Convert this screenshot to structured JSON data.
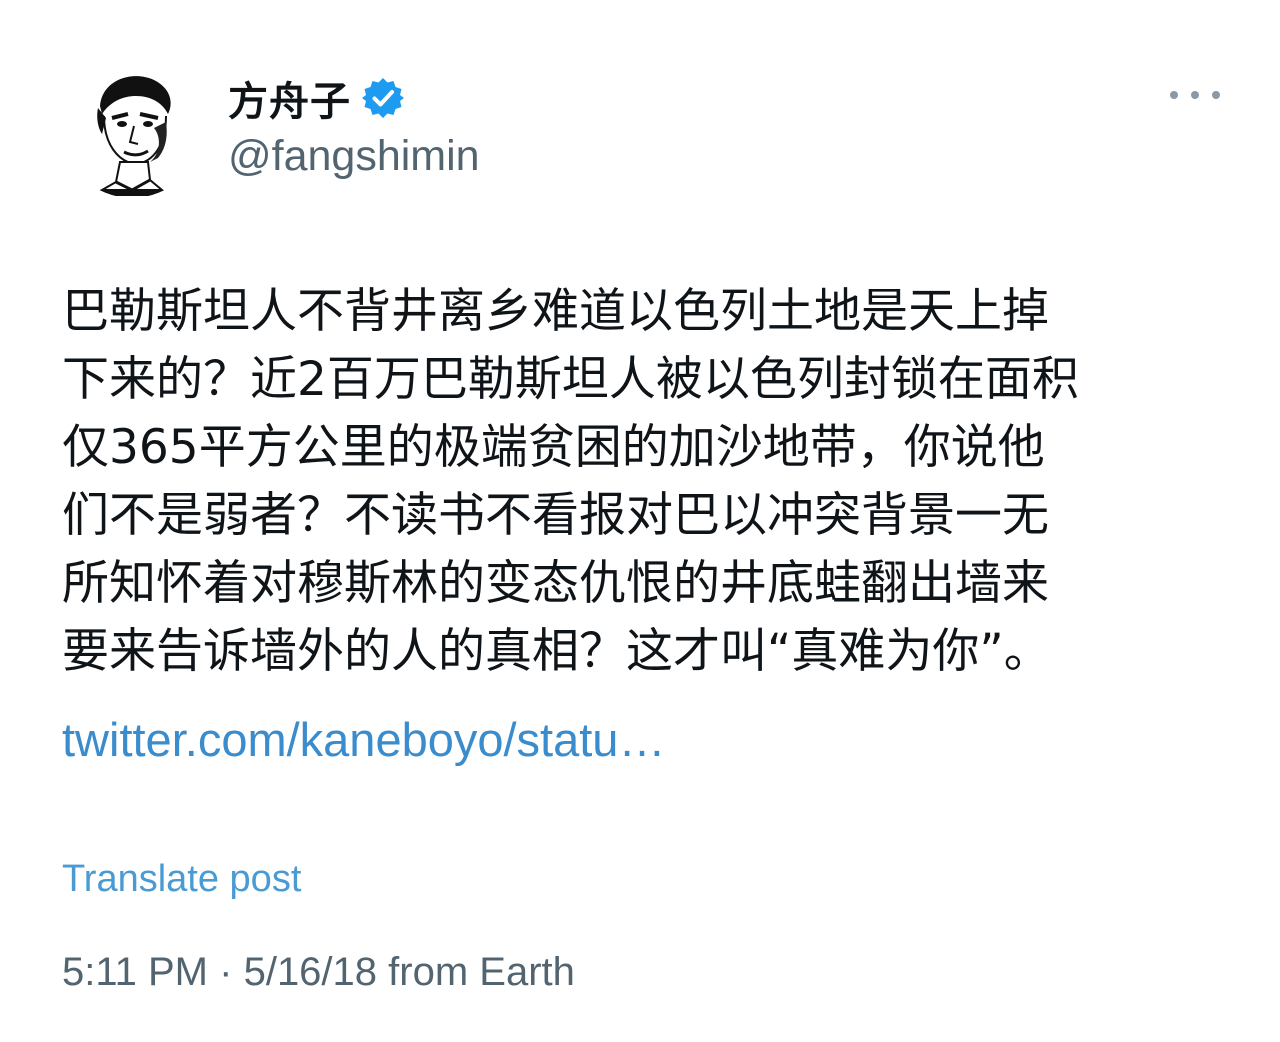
{
  "author": {
    "display_name": "方舟子",
    "handle": "@fangshimin",
    "verified_icon": "verified-badge-icon"
  },
  "tweet": {
    "text_lines": [
      "巴勒斯坦人不背井离乡难道以色列土地是天上掉",
      "下来的？近2百万巴勒斯坦人被以色列封锁在面积",
      "仅365平方公里的极端贫困的加沙地带，你说他",
      "们不是弱者？不读书不看报对巴以冲突背景一无",
      "所知怀着对穆斯林的变态仇恨的井底蛙翻出墙来",
      "要来告诉墙外的人的真相？这才叫“真难为你”。"
    ],
    "link": "twitter.com/kaneboyo/statu…",
    "translate_label": "Translate post",
    "time": "5:11 PM",
    "separator": "·",
    "date": "5/16/18",
    "source": "from Earth"
  },
  "colors": {
    "link": "#3a8ccc",
    "secondary_text": "#536471",
    "verified": "#1d9bf0"
  }
}
